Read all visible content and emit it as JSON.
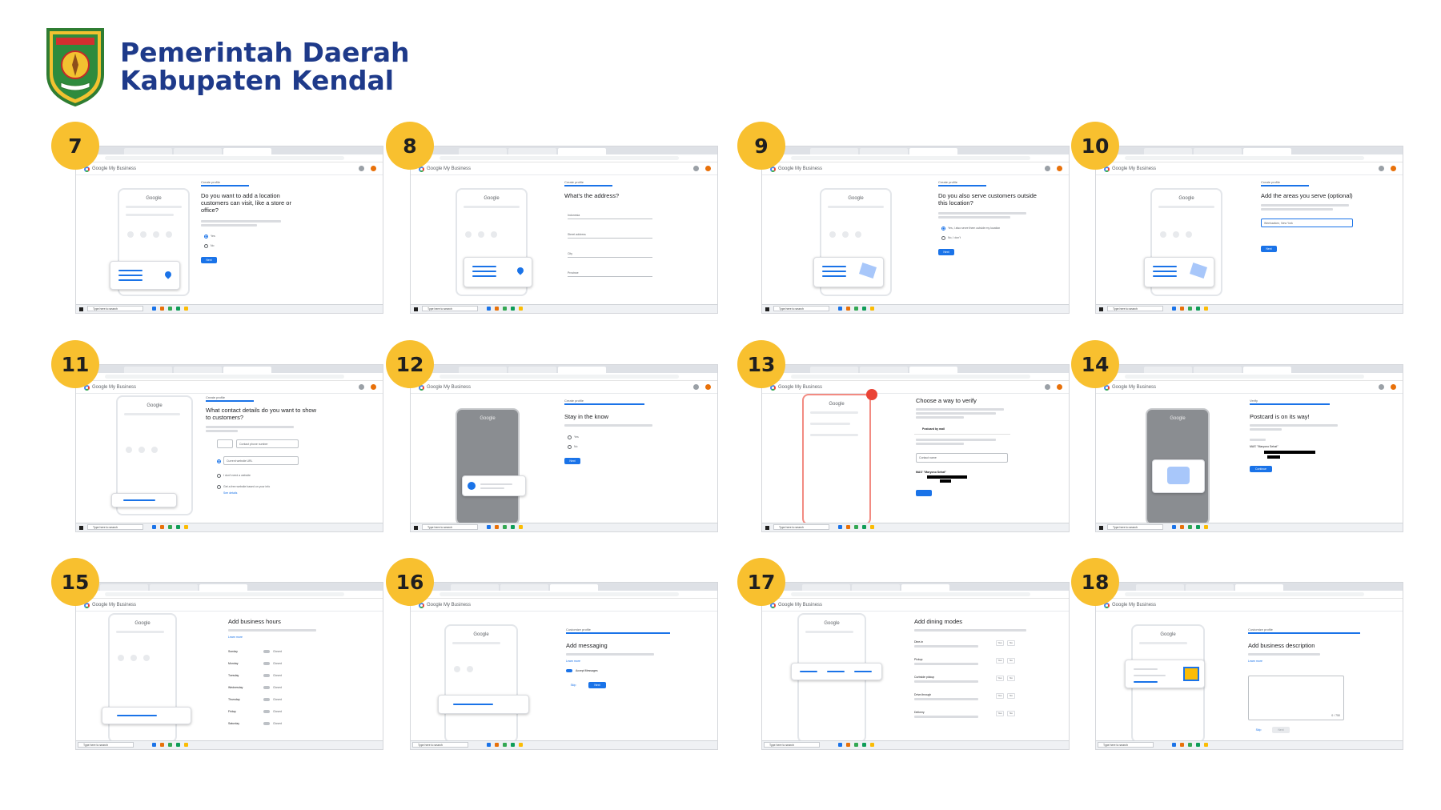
{
  "org": {
    "line1": "Pemerintah Daerah",
    "line2": "Kabupaten Kendal",
    "logo_text": "KENDAL",
    "logo_top_text": "NGESTI WIBOWO"
  },
  "common": {
    "app_name": "Google My Business",
    "google": "Google",
    "taskbar_search": "Type here to search",
    "create_profile": "Create profile",
    "next": "Next",
    "skip": "Skip"
  },
  "steps": [
    {
      "num": "7",
      "title": "Do you want to add a location customers can visit, like a store or office?",
      "opts": [
        "Yes",
        "No"
      ]
    },
    {
      "num": "8",
      "title": "What's the address?",
      "fields": [
        "Indonesia",
        "Street address",
        "City",
        "Province"
      ]
    },
    {
      "num": "9",
      "title": "Do you also serve customers outside this location?",
      "opts": [
        "Yes, I also serve them outside my location",
        "No, I don't"
      ]
    },
    {
      "num": "10",
      "title": "Add the areas you serve (optional)",
      "input": "Weehawken, New York"
    },
    {
      "num": "11",
      "title": "What contact details do you want to show to customers?",
      "phone_placeholder": "Contact phone number",
      "url_placeholder": "Current website URL",
      "opts": [
        "I don't need a website",
        "Get a free website based on your info"
      ],
      "link": "See details"
    },
    {
      "num": "12",
      "title": "Stay in the know",
      "opts": [
        "Yes",
        "No"
      ]
    },
    {
      "num": "13",
      "title": "Choose a way to verify",
      "method": "Postcard by mail",
      "contact_placeholder": "Contact name",
      "business": "MAS' \"Maryono Sehat\""
    },
    {
      "num": "14",
      "label": "Verify",
      "title": "Postcard is on its way!",
      "business": "MAS' \"Maryono Sehat\"",
      "button": "Continue"
    },
    {
      "num": "15",
      "title": "Add business hours",
      "days": [
        "Sunday",
        "Monday",
        "Tuesday",
        "Wednesday",
        "Thursday",
        "Friday",
        "Saturday"
      ],
      "closed": "Closed"
    },
    {
      "num": "16",
      "label": "Customize profile",
      "title": "Add messaging",
      "toggle_label": "Accept Messages",
      "link": "Learn more"
    },
    {
      "num": "17",
      "title": "Add dining modes",
      "modes": [
        "Dine-in",
        "Pickup",
        "Curbside pickup",
        "Drive-through",
        "Delivery"
      ],
      "yes": "Yes",
      "no": "No"
    },
    {
      "num": "18",
      "label": "Customize profile",
      "title": "Add business description",
      "counter": "0 / 750",
      "link": "Learn more"
    }
  ],
  "colors": {
    "badge": "#f8c02f",
    "brand": "#1e3a8a",
    "accent": "#1a73e8"
  }
}
